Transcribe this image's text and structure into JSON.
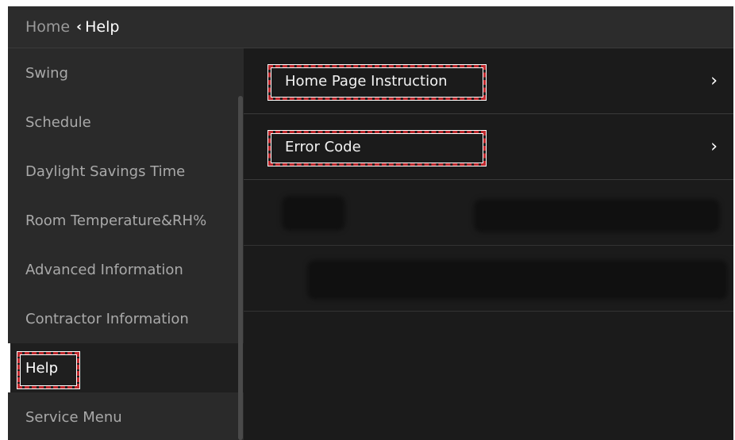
{
  "header": {
    "home": "Home",
    "separator_icon": "chevron-left-icon",
    "separator_glyph": "‹",
    "current": "Help"
  },
  "sidebar": {
    "items": [
      {
        "label": "Swing"
      },
      {
        "label": "Schedule"
      },
      {
        "label": "Daylight Savings Time"
      },
      {
        "label": "Room Temperature&RH%"
      },
      {
        "label": "Advanced Information"
      },
      {
        "label": "Contractor Information"
      },
      {
        "label": "Help",
        "selected": true
      },
      {
        "label": "Service Menu"
      }
    ]
  },
  "content": {
    "rows": [
      {
        "label": "Home Page Instruction",
        "chevron_icon": "chevron-right-icon",
        "chevron": "›"
      },
      {
        "label": "Error Code",
        "chevron_icon": "chevron-right-icon",
        "chevron": "›"
      }
    ]
  },
  "colors": {
    "header_bg": "#2c2c2c",
    "sidebar_bg": "#2a2a2a",
    "content_bg": "#1b1b1b",
    "highlight_dash": "#c0282d"
  }
}
